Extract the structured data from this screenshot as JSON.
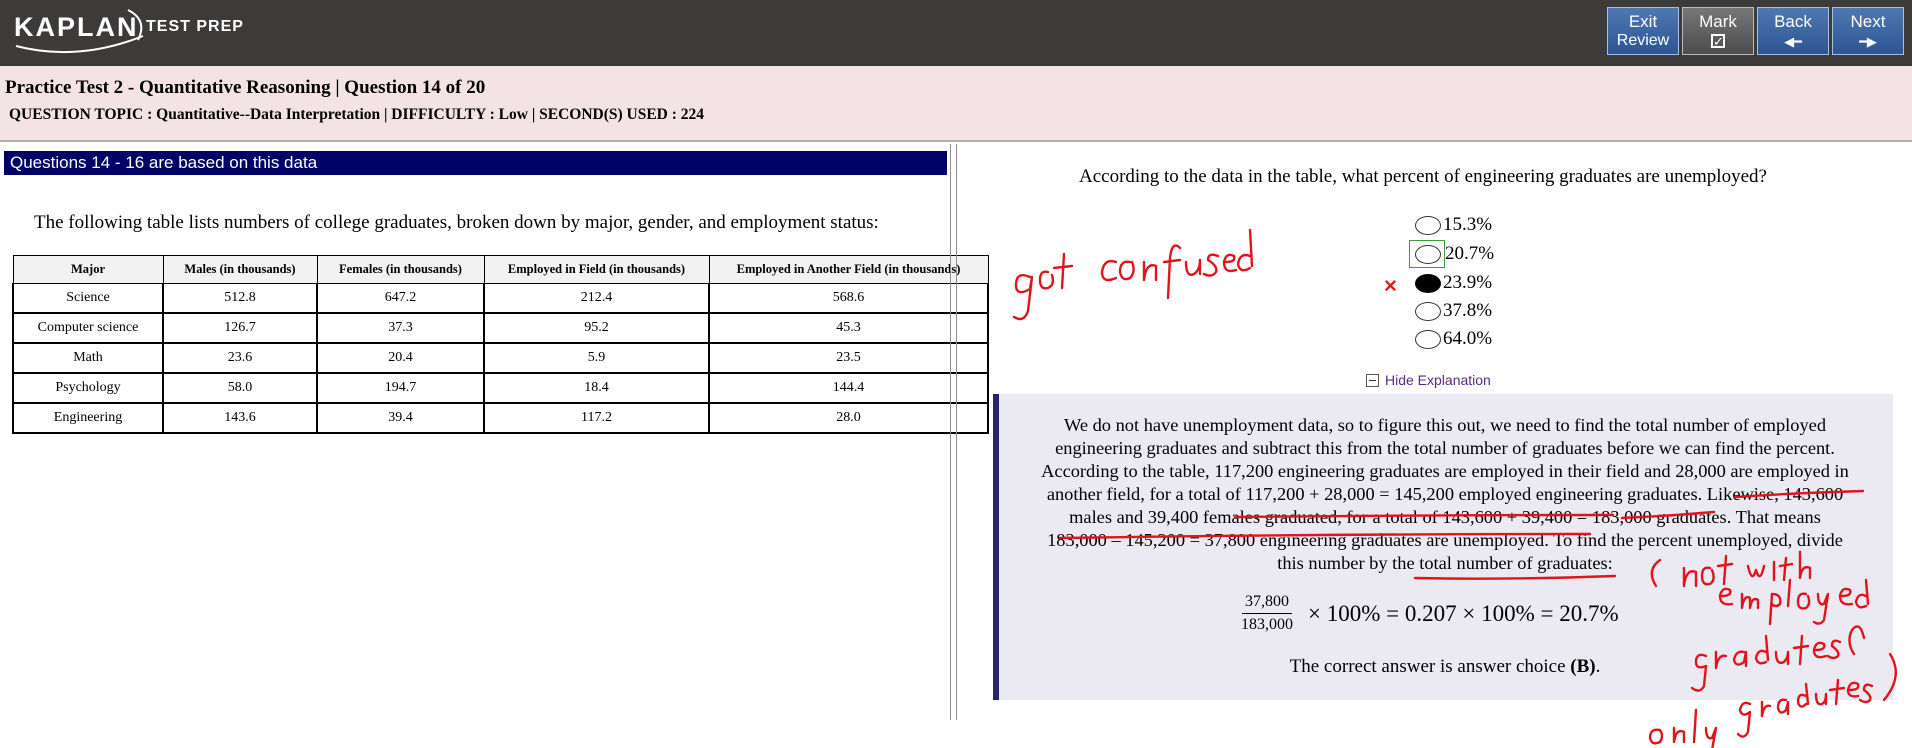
{
  "header": {
    "logo_text": "KAPLAN",
    "logo_subtext": "TEST PREP",
    "buttons": {
      "exit_line1": "Exit",
      "exit_line2": "Review",
      "mark": "Mark",
      "back": "Back",
      "next": "Next"
    }
  },
  "info": {
    "title": "Practice Test 2 - Quantitative Reasoning | Question  14 of 20",
    "topic": "QUESTION TOPIC : Quantitative--Data Interpretation | DIFFICULTY : Low | SECOND(S) USED : 224"
  },
  "left": {
    "heading": "Questions 14 - 16 are based on this data",
    "intro": "The following table lists numbers of college graduates, broken down by major, gender, and employment status:",
    "table": {
      "headers": [
        "Major",
        "Males (in thousands)",
        "Females (in thousands)",
        "Employed in Field (in thousands)",
        "Employed in Another Field (in thousands)"
      ],
      "rows": [
        [
          "Science",
          "512.8",
          "647.2",
          "212.4",
          "568.6"
        ],
        [
          "Computer science",
          "126.7",
          "37.3",
          "95.2",
          "45.3"
        ],
        [
          "Math",
          "23.6",
          "20.4",
          "5.9",
          "23.5"
        ],
        [
          "Psychology",
          "58.0",
          "194.7",
          "18.4",
          "144.4"
        ],
        [
          "Engineering",
          "143.6",
          "39.4",
          "117.2",
          "28.0"
        ]
      ]
    }
  },
  "right": {
    "question": "According to the data in the table, what percent of engineering graduates are unemployed?",
    "choices": [
      "15.3%",
      "20.7%",
      "23.9%",
      "37.8%",
      "64.0%"
    ],
    "selected_choice": "23.9%",
    "incorrect_mark": "×",
    "hide_explanation": "Hide Explanation",
    "explanation": {
      "line1": "We do not have unemployment data, so to figure this out, we need to find the total number of employed",
      "line2": "engineering graduates and subtract this from the total number of graduates before we can find the percent.",
      "line3": "According to the table, 117,200 engineering graduates are employed in their field and 28,000 are employed in",
      "line4": "another field, for a total of 117,200 + 28,000 = 145,200 employed engineering graduates. Likewise, 143,600",
      "line5": "males and 39,400 females graduated, for a total of 143,600 + 39,400 = 183,000 graduates. That means",
      "line6": "183,000 – 145,200 = 37,800 engineering graduates are unemployed. To find the percent unemployed, divide",
      "line7": "this number by the total number of graduates:",
      "formula_num": "37,800",
      "formula_den": "183,000",
      "formula_rest": "× 100% = 0.207 × 100% = 20.7%",
      "answer_prefix": "The correct answer is answer choice ",
      "answer_choice": "(B)",
      "answer_suffix": "."
    }
  },
  "annotations": {
    "note1": "got confused",
    "note2": "( not with employed graduates only graduates)",
    "ink_color": "#e0141c"
  }
}
